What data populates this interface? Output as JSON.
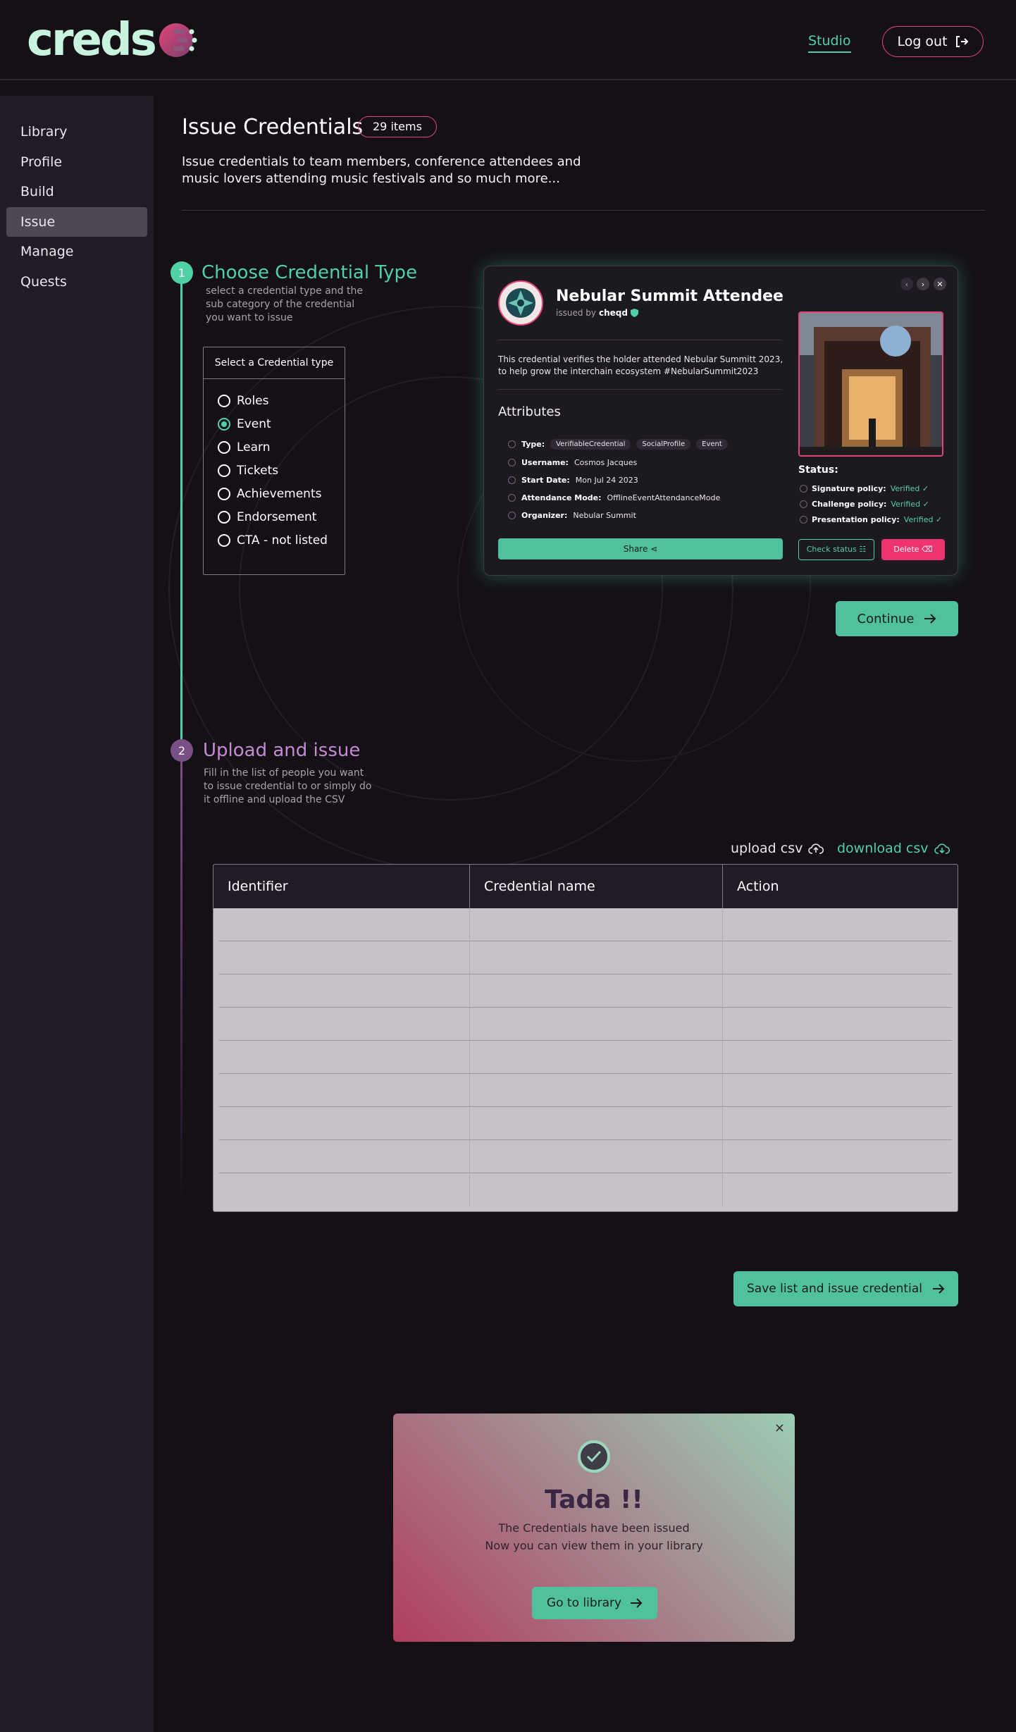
{
  "header": {
    "logo_text": "creds",
    "nav_studio": "Studio",
    "logout_label": "Log out",
    "logout_icon": "log-out-icon"
  },
  "sidebar": {
    "items": [
      {
        "label": "Library"
      },
      {
        "label": "Profile"
      },
      {
        "label": "Build"
      },
      {
        "label": "Issue",
        "active": true
      },
      {
        "label": "Manage"
      },
      {
        "label": "Quests"
      }
    ]
  },
  "main": {
    "title": "Issue Credentials",
    "items_badge": "29 items",
    "description": "Issue credentials to team members, conference attendees and music lovers attending  music festivals and so much more..."
  },
  "step1": {
    "number": "1",
    "title": "Choose Credential Type",
    "description": "select a  credential  type and the sub category of the credential you want to issue",
    "selector_title": "Select a Credential type",
    "options": [
      {
        "label": "Roles",
        "selected": false
      },
      {
        "label": "Event",
        "selected": true
      },
      {
        "label": "Learn",
        "selected": false
      },
      {
        "label": "Tickets",
        "selected": false
      },
      {
        "label": "Achievements",
        "selected": false
      },
      {
        "label": "Endorsement",
        "selected": false
      },
      {
        "label": "CTA - not listed",
        "selected": false
      }
    ],
    "continue_label": "Continue"
  },
  "card": {
    "title": "Nebular Summit Attendee",
    "issued_by_prefix": "issued by",
    "issuer": "cheqd",
    "description": "This credential verifies the holder attended Nebular Summitt 2023, to help grow the interchain ecosystem #NebularSummit2023",
    "attributes_title": "Attributes",
    "attributes": {
      "type_label": "Type:",
      "type_chips": [
        "VerifiableCredential",
        "SocialProfile",
        "Event"
      ],
      "username_label": "Username:",
      "username": "Cosmos Jacques",
      "start_date_label": "Start Date:",
      "start_date": "Mon Jul 24 2023",
      "attendance_mode_label": "Attendance Mode:",
      "attendance_mode": "OfflineEventAttendanceMode",
      "organizer_label": "Organizer:",
      "organizer": "Nebular Summit"
    },
    "status_title": "Status:",
    "status": [
      {
        "label": "Signature policy:",
        "value": "Verified ✓"
      },
      {
        "label": "Challenge policy:",
        "value": "Verified ✓"
      },
      {
        "label": "Presentation policy:",
        "value": "Verified ✓"
      }
    ],
    "share_label": "Share",
    "check_status_label": "Check status",
    "delete_label": "Delete"
  },
  "step2": {
    "number": "2",
    "title": "Upload and issue",
    "description": "Fill in the list of people you want to issue credential to or simply do it offline and  upload the CSV",
    "upload_csv": "upload csv",
    "download_csv": "download csv",
    "table_headers": [
      "Identifier",
      "Credential name",
      "Action"
    ],
    "table_row_count": 9,
    "save_label": "Save list and issue credential"
  },
  "modal": {
    "title": "Tada !!",
    "line1": "The Credentials have been issued",
    "line2": "Now you can view them in your library",
    "button_label": "Go to library",
    "close_symbol": "×"
  },
  "colors": {
    "accent_green": "#4fd1a5",
    "accent_pink": "#e0467a",
    "accent_purple": "#7a4f86",
    "background": "#141016",
    "sidebar": "#221a27"
  }
}
